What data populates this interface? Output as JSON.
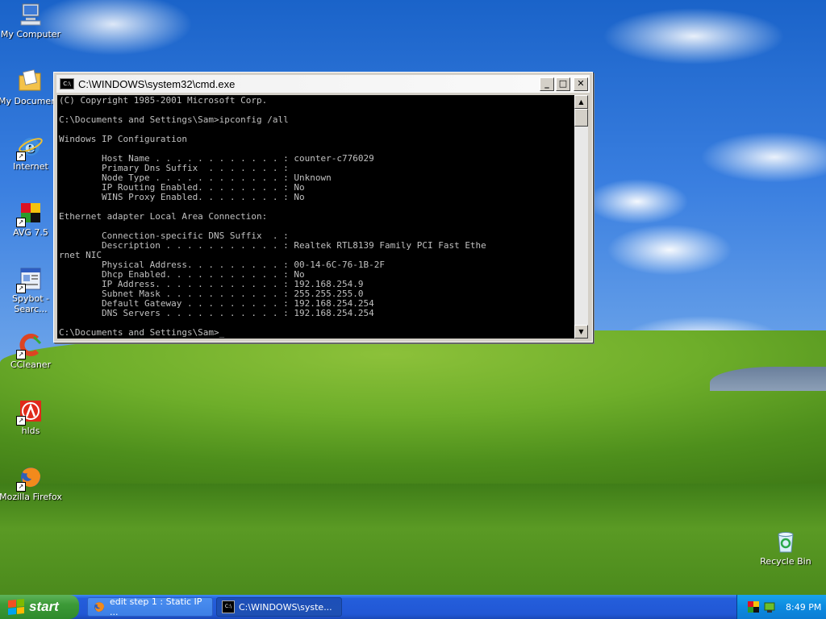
{
  "desktop": {
    "icons": [
      {
        "label": "My Computer"
      },
      {
        "label": "My Documents"
      },
      {
        "label": "Internet"
      },
      {
        "label": "AVG 7.5"
      },
      {
        "label": "Spybot - Searc..."
      },
      {
        "label": "CCleaner"
      },
      {
        "label": "hlds"
      },
      {
        "label": "Mozilla Firefox"
      },
      {
        "label": "Recycle Bin"
      }
    ]
  },
  "window": {
    "title": "C:\\WINDOWS\\system32\\cmd.exe",
    "buttons": {
      "minimize": "_",
      "maximize": "□",
      "close": "✕"
    },
    "console_text": "(C) Copyright 1985-2001 Microsoft Corp.\n\nC:\\Documents and Settings\\Sam>ipconfig /all\n\nWindows IP Configuration\n\n        Host Name . . . . . . . . . . . . : counter-c776029\n        Primary Dns Suffix  . . . . . . . :\n        Node Type . . . . . . . . . . . . : Unknown\n        IP Routing Enabled. . . . . . . . : No\n        WINS Proxy Enabled. . . . . . . . : No\n\nEthernet adapter Local Area Connection:\n\n        Connection-specific DNS Suffix  . :\n        Description . . . . . . . . . . . : Realtek RTL8139 Family PCI Fast Ethe\nrnet NIC\n        Physical Address. . . . . . . . . : 00-14-6C-76-1B-2F\n        Dhcp Enabled. . . . . . . . . . . : No\n        IP Address. . . . . . . . . . . . : 192.168.254.9\n        Subnet Mask . . . . . . . . . . . : 255.255.255.0\n        Default Gateway . . . . . . . . . : 192.168.254.254\n        DNS Servers . . . . . . . . . . . : 192.168.254.254\n\nC:\\Documents and Settings\\Sam>_"
  },
  "taskbar": {
    "start_label": "start",
    "tasks": [
      {
        "label": "edit step 1 : Static IP ..."
      },
      {
        "label": "C:\\WINDOWS\\syste..."
      }
    ],
    "clock": "8:49 PM"
  }
}
